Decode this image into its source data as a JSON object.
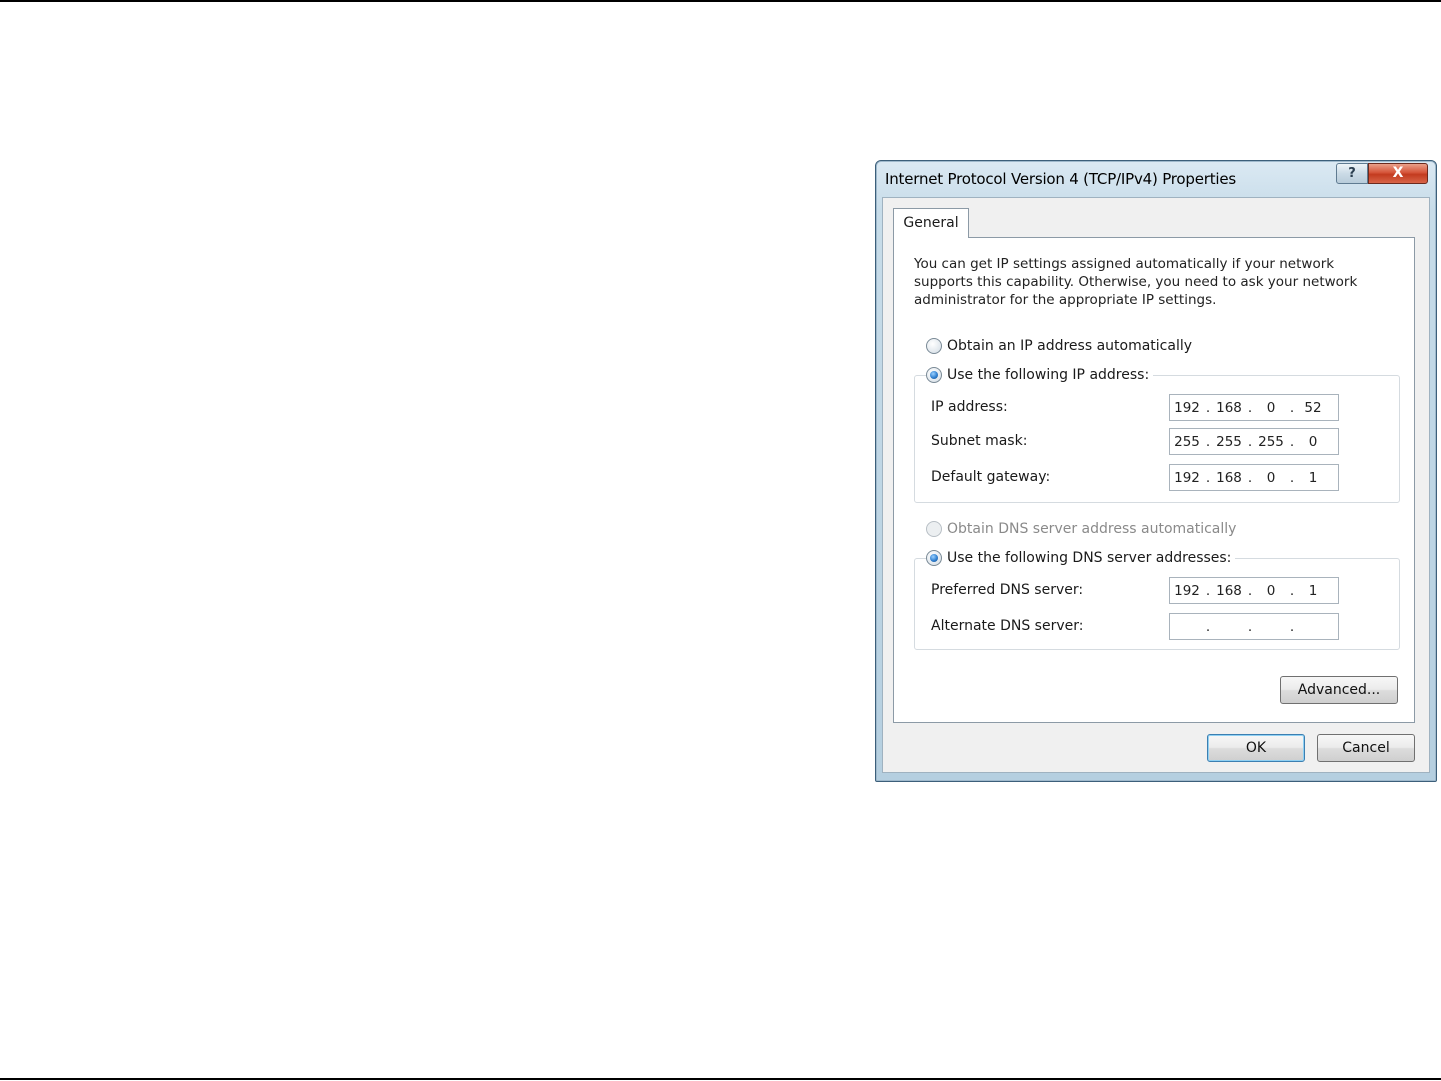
{
  "dialog": {
    "title": "Internet Protocol Version 4 (TCP/IPv4) Properties",
    "help_glyph": "?",
    "close_glyph": "X"
  },
  "tabs": [
    {
      "label": "General",
      "selected": true
    }
  ],
  "intro": "You can get IP settings assigned automatically if your network supports this capability. Otherwise, you need to ask your network administrator for the appropriate IP settings.",
  "ip_mode": {
    "auto_label": "Obtain an IP address automatically",
    "manual_label": "Use the following IP address:",
    "selected": "manual"
  },
  "ip_fields": [
    {
      "label": "IP address:",
      "octets": [
        "192",
        "168",
        "0",
        "52"
      ]
    },
    {
      "label": "Subnet mask:",
      "octets": [
        "255",
        "255",
        "255",
        "0"
      ]
    },
    {
      "label": "Default gateway:",
      "octets": [
        "192",
        "168",
        "0",
        "1"
      ]
    }
  ],
  "dns_mode": {
    "auto_label": "Obtain DNS server address automatically",
    "auto_disabled": true,
    "manual_label": "Use the following DNS server addresses:",
    "selected": "manual"
  },
  "dns_fields": [
    {
      "label": "Preferred DNS server:",
      "octets": [
        "192",
        "168",
        "0",
        "1"
      ]
    },
    {
      "label": "Alternate DNS server:",
      "octets": [
        "",
        "",
        "",
        ""
      ]
    }
  ],
  "buttons": {
    "advanced": "Advanced...",
    "ok": "OK",
    "cancel": "Cancel"
  }
}
